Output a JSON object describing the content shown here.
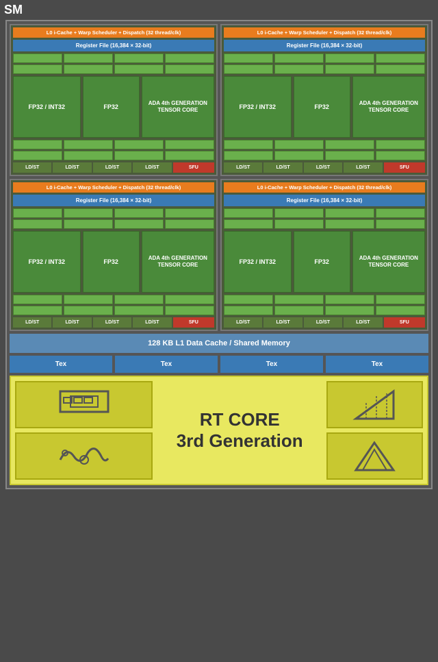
{
  "sm": {
    "title": "SM",
    "quads": [
      {
        "l0": "L0 i-Cache + Warp Scheduler + Dispatch (32 thread/clk)",
        "regfile": "Register File (16,384 × 32-bit)",
        "fp32_int32": "FP32 / INT32",
        "fp32": "FP32",
        "tensor": "ADA 4th GENERATION TENSOR CORE",
        "ldst_labels": [
          "LD/ST",
          "LD/ST",
          "LD/ST",
          "LD/ST"
        ],
        "sfu": "SFU"
      },
      {
        "l0": "L0 i-Cache + Warp Scheduler + Dispatch (32 thread/clk)",
        "regfile": "Register File (16,384 × 32-bit)",
        "fp32_int32": "FP32 / INT32",
        "fp32": "FP32",
        "tensor": "ADA 4th GENERATION TENSOR CORE",
        "ldst_labels": [
          "LD/ST",
          "LD/ST",
          "LD/ST",
          "LD/ST"
        ],
        "sfu": "SFU"
      },
      {
        "l0": "L0 i-Cache + Warp Scheduler + Dispatch (32 thread/clk)",
        "regfile": "Register File (16,384 × 32-bit)",
        "fp32_int32": "FP32 / INT32",
        "fp32": "FP32",
        "tensor": "ADA 4th GENERATION TENSOR CORE",
        "ldst_labels": [
          "LD/ST",
          "LD/ST",
          "LD/ST",
          "LD/ST"
        ],
        "sfu": "SFU"
      },
      {
        "l0": "L0 i-Cache + Warp Scheduler + Dispatch (32 thread/clk)",
        "regfile": "Register File (16,384 × 32-bit)",
        "fp32_int32": "FP32 / INT32",
        "fp32": "FP32",
        "tensor": "ADA 4th GENERATION TENSOR CORE",
        "ldst_labels": [
          "LD/ST",
          "LD/ST",
          "LD/ST",
          "LD/ST"
        ],
        "sfu": "SFU"
      }
    ],
    "l1_cache": "128 KB L1 Data Cache / Shared Memory",
    "tex_labels": [
      "Tex",
      "Tex",
      "Tex",
      "Tex"
    ],
    "rt_core": {
      "label": "RT CORE",
      "generation": "3rd Generation"
    }
  }
}
